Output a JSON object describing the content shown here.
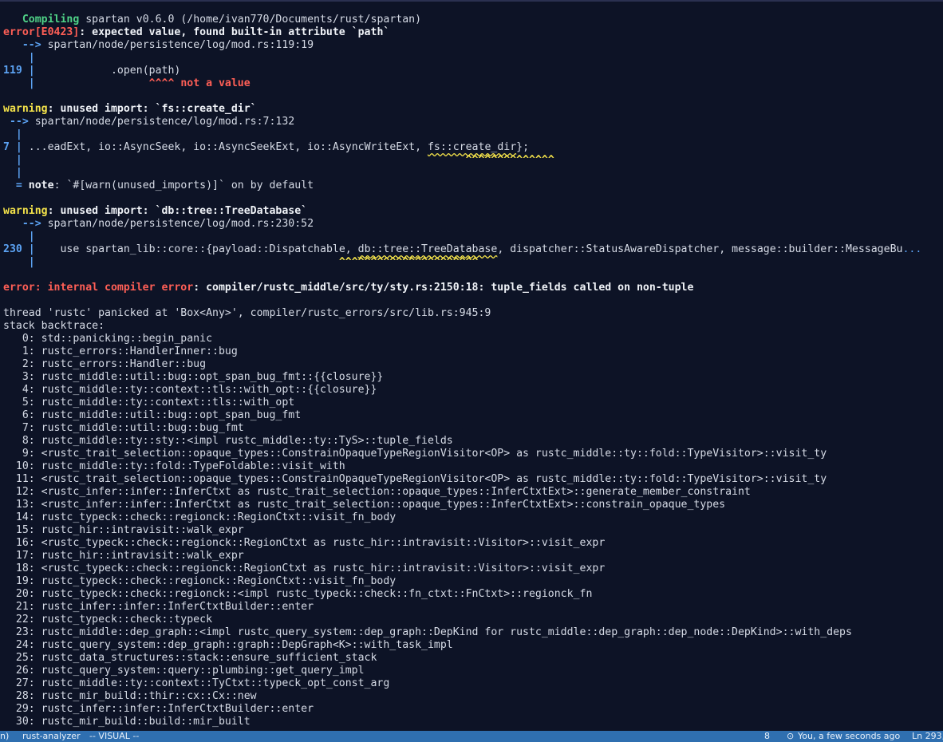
{
  "terminal": {
    "compiling": {
      "keyword": "Compiling",
      "text": " spartan v0.6.0 (/home/ivan770/Documents/rust/spartan)"
    },
    "err1": {
      "code": "error[E0423]",
      "msg": ": expected value, found built-in attribute `path`",
      "loc_arrow": "-->",
      "loc": " spartan/node/persistence/log/mod.rs:119:19",
      "line_no": "119",
      "code_line": "            .open(path)",
      "carets": "^^^^",
      "caret_msg": " not a value"
    },
    "warn1": {
      "label": "warning",
      "msg": ": unused import: `fs::create_dir`",
      "loc_arrow": "-->",
      "loc": " spartan/node/persistence/log/mod.rs:7:132",
      "line_no": "7",
      "code_prefix": " ...eadExt, io::AsyncSeek, io::AsyncSeekExt, io::AsyncWriteExt, ",
      "code_highlight": "fs::create_dir",
      "code_suffix": "};",
      "carets": "^^^^^^^^^^^^^^",
      "note_eq": "=",
      "note_label": "note",
      "note_msg": ": `#[warn(unused_imports)]` on by default"
    },
    "warn2": {
      "label": "warning",
      "msg": ": unused import: `db::tree::TreeDatabase`",
      "loc_arrow": "-->",
      "loc": " spartan/node/persistence/log/mod.rs:230:52",
      "line_no": "230",
      "code_prefix": "    use spartan_lib::core::{payload::Dispatchable, ",
      "code_highlight": "db::tree::TreeDatabase",
      "code_suffix": ", dispatcher::StatusAwareDispatcher, message::builder::MessageBu",
      "ellipsis": "...",
      "carets": "^^^^^^^^^^^^^^^^^^^^^^"
    },
    "ice": {
      "label": "error: internal compiler error",
      "msg": ": compiler/rustc_middle/src/ty/sty.rs:2150:18: tuple_fields called on non-tuple"
    },
    "panic": "thread 'rustc' panicked at 'Box<Any>', compiler/rustc_errors/src/lib.rs:945:9",
    "backtrace_header": "stack backtrace:",
    "frames": [
      "   0: std::panicking::begin_panic",
      "   1: rustc_errors::HandlerInner::bug",
      "   2: rustc_errors::Handler::bug",
      "   3: rustc_middle::util::bug::opt_span_bug_fmt::{{closure}}",
      "   4: rustc_middle::ty::context::tls::with_opt::{{closure}}",
      "   5: rustc_middle::ty::context::tls::with_opt",
      "   6: rustc_middle::util::bug::opt_span_bug_fmt",
      "   7: rustc_middle::util::bug::bug_fmt",
      "   8: rustc_middle::ty::sty::<impl rustc_middle::ty::TyS>::tuple_fields",
      "   9: <rustc_trait_selection::opaque_types::ConstrainOpaqueTypeRegionVisitor<OP> as rustc_middle::ty::fold::TypeVisitor>::visit_ty",
      "  10: rustc_middle::ty::fold::TypeFoldable::visit_with",
      "  11: <rustc_trait_selection::opaque_types::ConstrainOpaqueTypeRegionVisitor<OP> as rustc_middle::ty::fold::TypeVisitor>::visit_ty",
      "  12: <rustc_infer::infer::InferCtxt as rustc_trait_selection::opaque_types::InferCtxtExt>::generate_member_constraint",
      "  13: <rustc_infer::infer::InferCtxt as rustc_trait_selection::opaque_types::InferCtxtExt>::constrain_opaque_types",
      "  14: rustc_typeck::check::regionck::RegionCtxt::visit_fn_body",
      "  15: rustc_hir::intravisit::walk_expr",
      "  16: <rustc_typeck::check::regionck::RegionCtxt as rustc_hir::intravisit::Visitor>::visit_expr",
      "  17: rustc_hir::intravisit::walk_expr",
      "  18: <rustc_typeck::check::regionck::RegionCtxt as rustc_hir::intravisit::Visitor>::visit_expr",
      "  19: rustc_typeck::check::regionck::RegionCtxt::visit_fn_body",
      "  20: rustc_typeck::check::regionck::<impl rustc_typeck::check::fn_ctxt::FnCtxt>::regionck_fn",
      "  21: rustc_infer::infer::InferCtxtBuilder::enter",
      "  22: rustc_typeck::check::typeck",
      "  23: rustc_middle::dep_graph::<impl rustc_query_system::dep_graph::DepKind for rustc_middle::dep_graph::dep_node::DepKind>::with_deps",
      "  24: rustc_query_system::dep_graph::graph::DepGraph<K>::with_task_impl",
      "  25: rustc_data_structures::stack::ensure_sufficient_stack",
      "  26: rustc_query_system::query::plumbing::get_query_impl",
      "  27: rustc_middle::ty::context::TyCtxt::typeck_opt_const_arg",
      "  28: rustc_mir_build::thir::cx::Cx::new",
      "  29: rustc_infer::infer::InferCtxtBuilder::enter",
      "  30: rustc_mir_build::build::mir_built"
    ]
  },
  "statusbar": {
    "left_fragment": "n)",
    "lsp": "rust-analyzer",
    "mode": "-- VISUAL --",
    "number": "8",
    "blame_icon": "git-commit-icon",
    "blame_glyph": "⊙",
    "blame": "You, a few seconds ago",
    "position": "Ln 293,"
  }
}
